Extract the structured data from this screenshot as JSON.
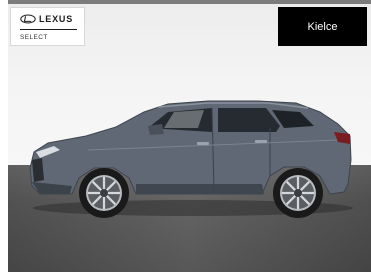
{
  "logo": {
    "wordmark": "LEXUS",
    "subline": "SELECT",
    "icon": "lexus-emblem-icon"
  },
  "location_badge": {
    "label": "Kielce"
  },
  "photo": {
    "subject": "car-side-view",
    "body_color": "#5f6874",
    "background_color": "#f2f2f2",
    "floor_color": "#5a5a5a"
  }
}
